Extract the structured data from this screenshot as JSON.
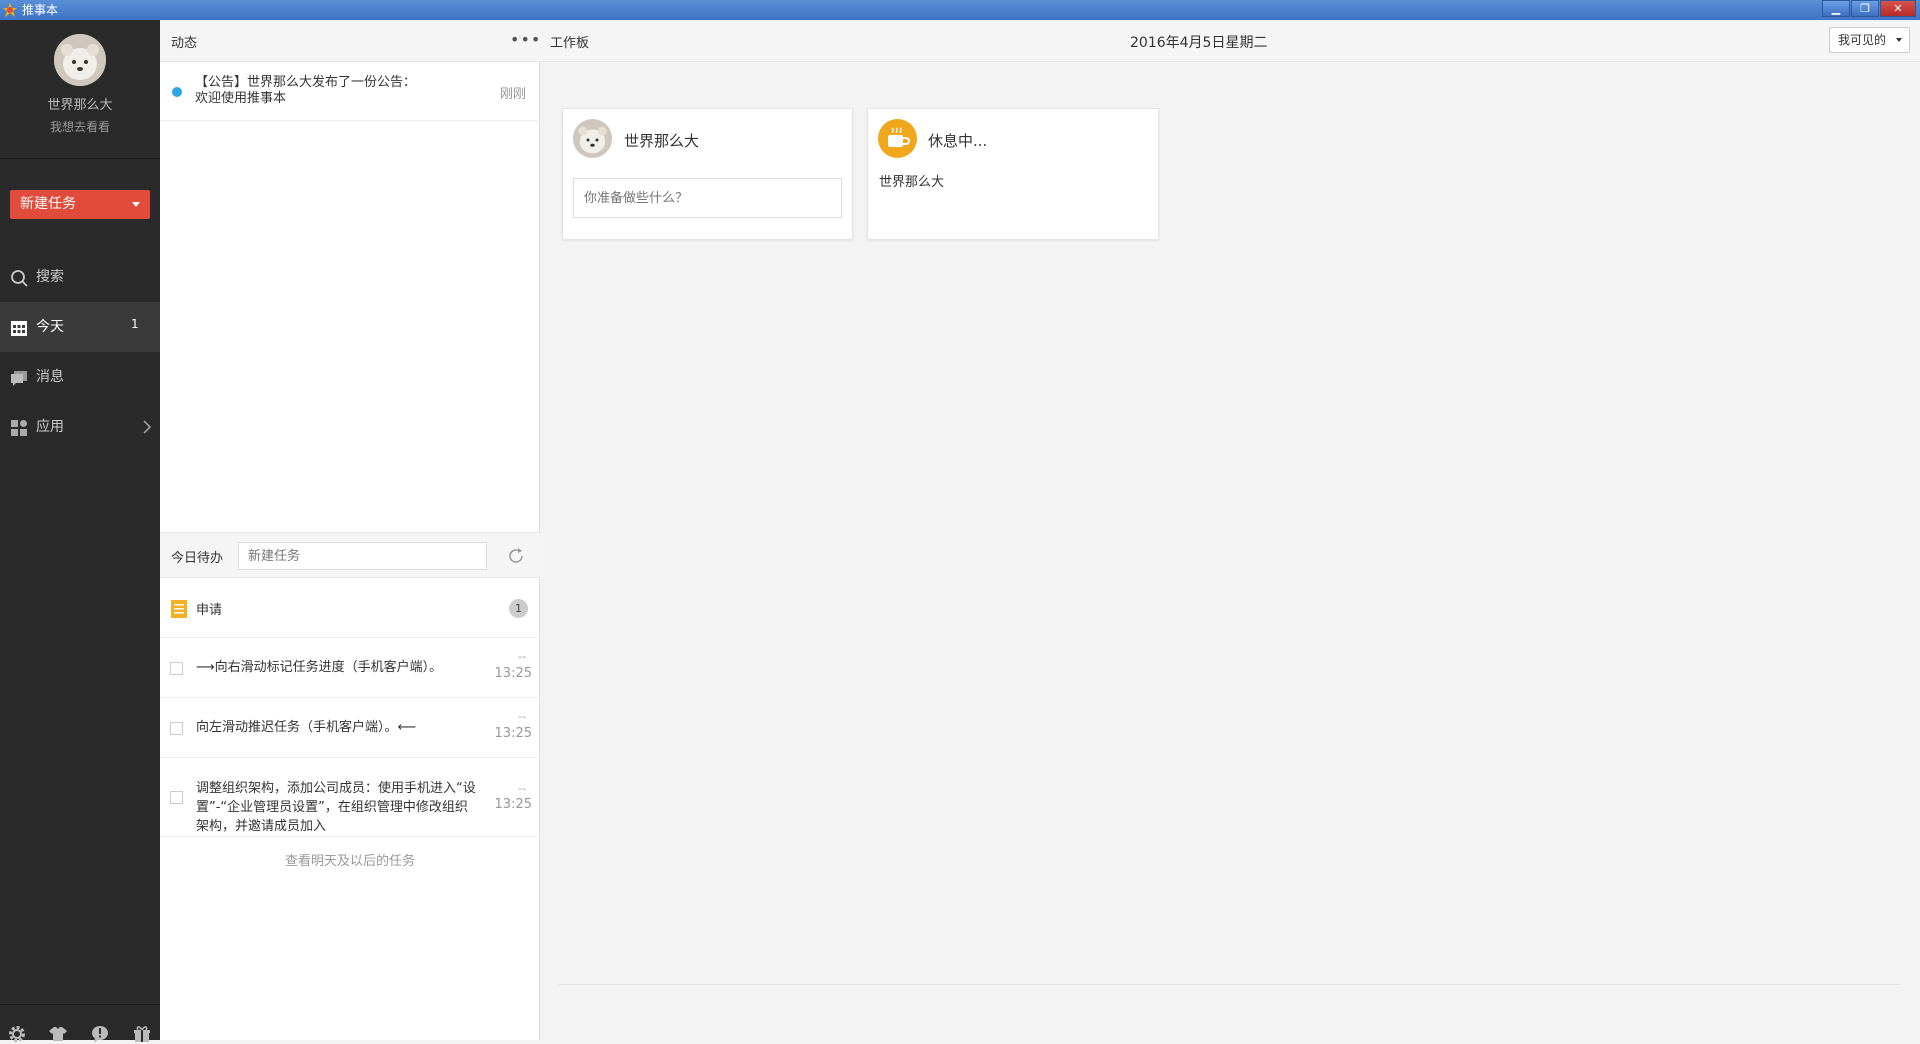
{
  "window": {
    "title": "推事本",
    "controls": {
      "minimize": "▁",
      "restore": "❐",
      "close": "✕"
    }
  },
  "user": {
    "name": "世界那么大",
    "signature": "我想去看看"
  },
  "sidebar": {
    "new_task_label": "新建任务",
    "items": [
      {
        "label": "搜索",
        "icon": "search-icon"
      },
      {
        "label": "今天",
        "icon": "calendar-icon",
        "badge": "1"
      },
      {
        "label": "消息",
        "icon": "message-icon"
      },
      {
        "label": "应用",
        "icon": "apps-icon"
      }
    ],
    "footer_icons": [
      "settings-icon",
      "shirt-icon",
      "feedback-icon",
      "gift-icon"
    ]
  },
  "feed": {
    "title": "动态",
    "more": "•••",
    "items": [
      {
        "text": "【公告】世界那么大发布了一份公告：欢迎使用推事本",
        "time": "刚刚"
      }
    ]
  },
  "todo": {
    "title": "今日待办",
    "input_placeholder": "新建任务",
    "apply": {
      "label": "申请",
      "count": "1"
    },
    "tasks": [
      {
        "text": "⟶向右滑动标记任务进度（手机客户端）。",
        "dash": "--",
        "time": "13:25"
      },
      {
        "text": "向左滑动推迟任务（手机客户端）。⟵",
        "dash": "--",
        "time": "13:25"
      },
      {
        "text": "调整组织架构，添加公司成员：使用手机进入“设置”-“企业管理员设置”，在组织管理中修改组织架构，并邀请成员加入",
        "dash": "--",
        "time": "13:25"
      }
    ],
    "more_link": "查看明天及以后的任务"
  },
  "workboard": {
    "title": "工作板",
    "date": "2016年4月5日星期二",
    "visibility_label": "我可见的",
    "status_card": {
      "name": "世界那么大",
      "placeholder": "你准备做些什么？"
    },
    "rest_card": {
      "title": "休息中...",
      "user": "世界那么大"
    }
  },
  "colors": {
    "accent": "#e04b3c",
    "sidebar_bg": "#2a2a2a",
    "dot": "#2ea5e6",
    "rest_icon": "#f0a71c"
  }
}
